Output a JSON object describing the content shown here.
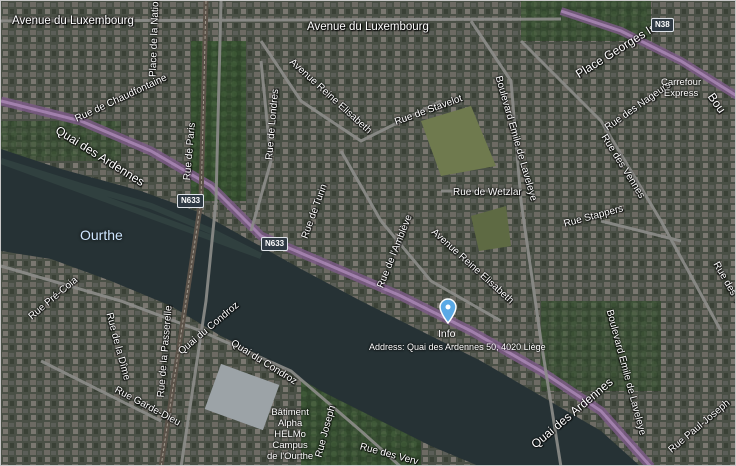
{
  "map": {
    "water_label": "Ourthe",
    "streets": {
      "avenue_luxembourg_1": "Avenue du Luxembourg",
      "avenue_luxembourg_2": "Avenue du Luxembourg",
      "place_nation": "Place de la Nation",
      "place_georges_ista": "Place Georges Ista",
      "bou": "Bou",
      "rue_chaudfontaine": "Rue de Chaudfontaine",
      "rue_paris": "Rue de Paris",
      "rue_londres": "Rue de Londres",
      "avenue_reine_elisabeth_1": "Avenue Reine Elisabeth",
      "rue_stavelot": "Rue de Stavelot",
      "boulevard_emile_laveleye_1": "Boulevard Emile de Laveleye",
      "rue_nageurs": "Rue des Nageurs",
      "rue_vennes": "Rue des Vennes",
      "quai_ardennes_1": "Quai des Ardennes",
      "rue_turin": "Rue de Turin",
      "rue_wetzlar": "Rue de Wetzlar",
      "rue_stappers": "Rue Stappers",
      "rue_ambleve": "Rue de l'Amblève",
      "avenue_reine_elisabeth_2": "Avenue Reine Elisabeth",
      "rue_pre_coia": "Rue Pré-Coia",
      "rue_passerelle": "Rue de la Passerelle",
      "rue_dime": "Rue de la Dîme",
      "quai_condroz_1": "Quai du Condroz",
      "quai_condroz_2": "Quai du Condroz",
      "rue_garde_dieu": "Rue Garde-Dieu",
      "rue_joseph": "Rue Joseph",
      "quai_ardennes_2": "Quai des Ardennes",
      "boulevard_emile_laveleye_2": "Boulevard Emile de Laveleye",
      "rue_vennes_2": "Rue des Vennes",
      "rue_paul_joseph": "Rue Paul-Joseph",
      "rue_verv": "Rue des Verv"
    },
    "shields": {
      "n38": "N38",
      "n633_a": "N633",
      "n633_b": "N633"
    },
    "pois": {
      "carrefour": "Carrefour\nExpress",
      "batiment": "Bâtiment\nAlpha\nHELMo\nCampus\nde l'Ourthe"
    },
    "pin": {
      "title": "Info",
      "address": "Address: Quai des Ardennes 50, 4020 Liège",
      "color": "#5aa9e6"
    }
  }
}
